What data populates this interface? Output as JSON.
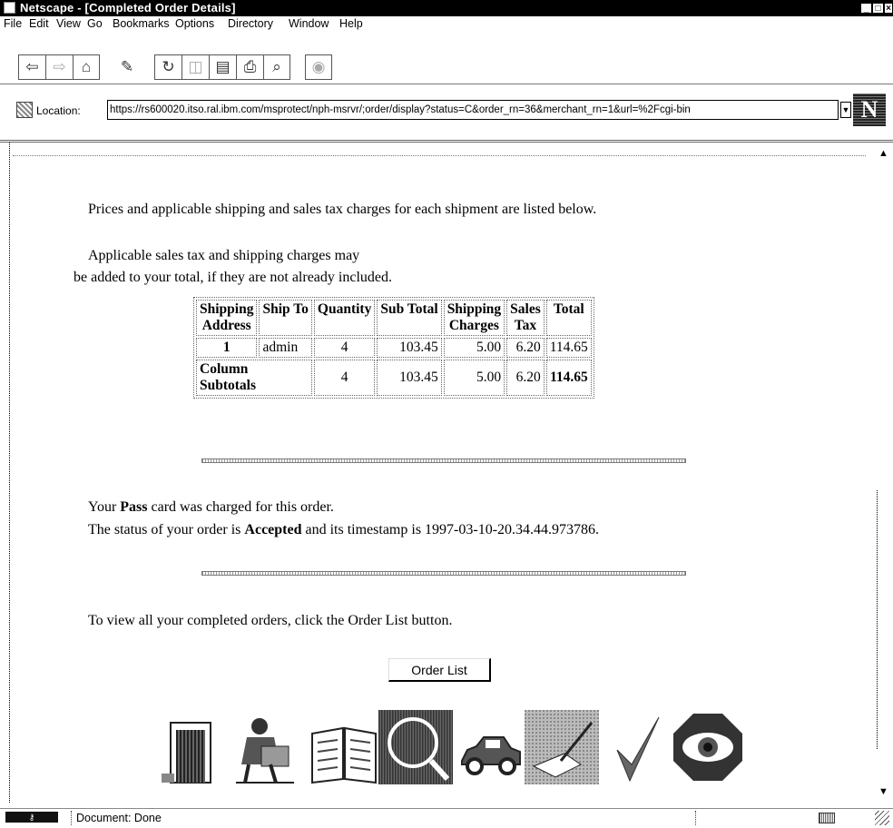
{
  "window": {
    "title": "Netscape - [Completed Order Details]"
  },
  "menu": {
    "items": [
      "File",
      "Edit",
      "View",
      "Go",
      "Bookmarks",
      "Options",
      "Directory",
      "Window",
      "Help"
    ]
  },
  "toolbar": {
    "buttons": [
      "back-icon",
      "forward-icon",
      "home-icon",
      "edit-icon",
      "reload-icon",
      "images-icon",
      "open-icon",
      "print-icon",
      "find-icon",
      "stop-icon"
    ]
  },
  "location": {
    "label": "Location:",
    "url": "https://rs600020.itso.ral.ibm.com/msprotect/nph-msrvr/;order/display?status=C&order_rn=36&merchant_rn=1&url=%2Fcgi-bin",
    "logo": "N"
  },
  "page": {
    "intro": "Prices and applicable shipping and sales tax charges for each shipment are listed below.",
    "note_line1": "Applicable sales tax and shipping charges may",
    "note_line2": "be added to your total, if they are not already included.",
    "table": {
      "headers": [
        [
          "Shipping",
          "Address"
        ],
        [
          "Ship To",
          ""
        ],
        [
          "Quantity",
          ""
        ],
        [
          "Sub Total",
          ""
        ],
        [
          "Shipping",
          "Charges"
        ],
        [
          "Sales",
          "Tax"
        ],
        [
          "Total",
          ""
        ]
      ],
      "row": {
        "address": "1",
        "ship_to": "admin",
        "quantity": "4",
        "sub_total": "103.45",
        "shipping": "5.00",
        "tax": "6.20",
        "total": "114.65"
      },
      "subtotal": {
        "label_line1": "Column",
        "label_line2": "Subtotals",
        "quantity": "4",
        "sub_total": "103.45",
        "shipping": "5.00",
        "tax": "6.20",
        "total": "114.65"
      }
    },
    "payment": {
      "prefix": "Your",
      "card": "Pass",
      "suffix": "card was charged for this order."
    },
    "status": {
      "prefix": "The status of your order is",
      "value": "Accepted",
      "middle": "and its timestamp is",
      "timestamp": "1997-03-10-20.34.44.973786."
    },
    "order_list_text": "To view all your completed orders, click the Order List button.",
    "order_list_button": "Order List",
    "nav_icons": [
      "store-door-icon",
      "shopper-icon",
      "catalog-book-icon",
      "search-magnifier-icon",
      "delivery-car-icon",
      "signing-hand-icon",
      "checkmark-icon",
      "eye-icon"
    ]
  },
  "statusbar": {
    "text": "Document: Done"
  },
  "colors": {
    "titlebar": "#000000",
    "background": "#ffffff",
    "text": "#000000"
  }
}
